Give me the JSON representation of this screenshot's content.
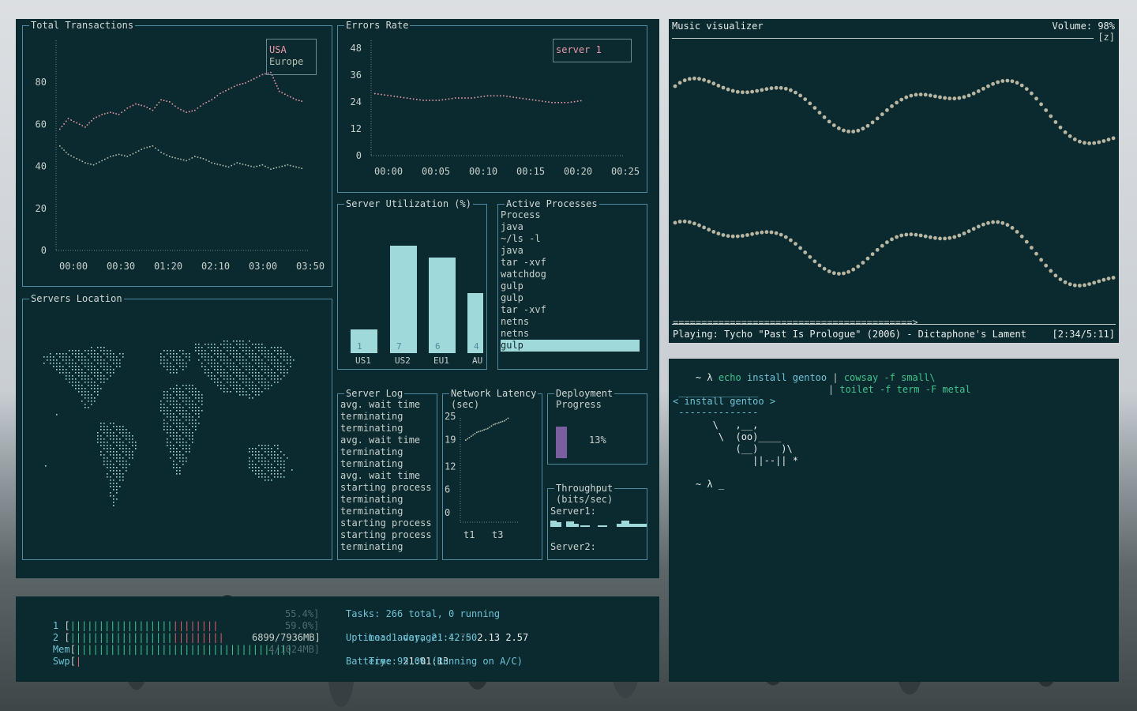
{
  "colors": {
    "panel_bg": "#0a2a30",
    "border": "#4e8aa0",
    "pink": "#e89aa6",
    "sage": "#b4bfb0",
    "bar": "#9fd9d9",
    "deploy": "#7a5ea0",
    "dots": "#b8b5a0"
  },
  "transactions": {
    "title": "Total Transactions",
    "legend": [
      "USA",
      "Europe"
    ],
    "yticks": [
      "80",
      "60",
      "40",
      "20",
      "0"
    ],
    "xticks": [
      "00:00",
      "00:30",
      "01:20",
      "02:10",
      "03:00",
      "03:50"
    ],
    "chart_data": {
      "type": "line",
      "ylim": [
        0,
        100
      ],
      "series": [
        {
          "name": "USA",
          "values": [
            58,
            63,
            61,
            59,
            63,
            65,
            66,
            65,
            68,
            70,
            69,
            67,
            72,
            71,
            68,
            66,
            67,
            70,
            72,
            75,
            77,
            79,
            80,
            82,
            84,
            85,
            76,
            74,
            72,
            71
          ]
        },
        {
          "name": "Europe",
          "values": [
            50,
            46,
            44,
            42,
            41,
            43,
            45,
            46,
            45,
            47,
            49,
            50,
            47,
            45,
            44,
            43,
            45,
            44,
            42,
            41,
            40,
            42,
            41,
            40,
            41,
            39,
            40,
            41,
            40,
            39
          ]
        }
      ]
    }
  },
  "errors": {
    "title": "Errors Rate",
    "legend": [
      "server 1"
    ],
    "yticks": [
      "48",
      "36",
      "24",
      "12",
      "0"
    ],
    "xticks": [
      "00:00",
      "00:05",
      "00:10",
      "00:15",
      "00:20",
      "00:25"
    ],
    "chart_data": {
      "type": "line",
      "ylim": [
        0,
        48
      ],
      "series": [
        {
          "name": "server 1",
          "values": [
            28,
            27,
            26,
            25,
            25,
            26,
            26,
            27,
            27,
            26,
            25,
            24,
            24,
            25
          ]
        }
      ]
    }
  },
  "utilization": {
    "title": "Server Utilization (%)",
    "chart_data": {
      "type": "bar",
      "categories": [
        "US1",
        "US2",
        "EU1",
        "AU"
      ],
      "values": [
        1,
        7,
        6,
        4
      ],
      "heights": [
        20,
        90,
        80,
        50
      ]
    }
  },
  "processes": {
    "title": "Active Processes",
    "header": "Process",
    "items": [
      "java",
      "~/ls -l",
      "java",
      "tar -xvf",
      "watchdog",
      "gulp",
      "gulp",
      "tar -xvf",
      "netns",
      "netns",
      "gulp"
    ]
  },
  "locations": {
    "title": "Servers Location"
  },
  "serverlog": {
    "title": "Server Log",
    "lines": [
      "avg. wait time",
      "terminating",
      "terminating",
      "avg. wait time",
      "terminating",
      "terminating",
      "avg. wait time",
      "starting process",
      "terminating",
      "terminating",
      "starting process",
      "starting process",
      "terminating"
    ]
  },
  "latency": {
    "title": "Network Latency",
    "subtitle": "(sec)",
    "yticks": [
      "25",
      "19",
      "12",
      "6",
      "0"
    ],
    "xticks": [
      "t1",
      "t3"
    ],
    "chart_data": {
      "type": "line",
      "ylim": [
        0,
        25
      ],
      "values": [
        19,
        20,
        21,
        21.5,
        22,
        23,
        23.5,
        24,
        25
      ]
    }
  },
  "deployment": {
    "title": "Deployment",
    "title2": "Progress",
    "value": "13%",
    "fraction": 0.13
  },
  "throughput": {
    "title": "Throughput",
    "subtitle": "(bits/sec)",
    "server1": "Server1:",
    "server2": "Server2:"
  },
  "visualizer": {
    "title": "Music visualizer",
    "volume": "Volume: 98%",
    "zoom": "[z]",
    "progress_bar": "==========================================>",
    "playing": "Playing: Tycho \"Past Is Prologue\" (2006) - Dictaphone's Lament",
    "time": "[2:34/5:11]"
  },
  "shell": {
    "prompt": "~ λ",
    "cmd1": "echo",
    "cmd1_args": "install gentoo",
    "pipe": "|",
    "cmd2": "cowsay -f small\\",
    "cmd3": "toilet -f term -F metal",
    "cow_line1": " ______________",
    "cow_say": "< install gentoo >",
    "cow_line2": " --------------",
    "cow_art": "       \\   ,__,\n        \\  (oo)____\n           (__)    )\\\n              ||--|| *",
    "prompt2": "~ λ",
    "cursor": "_"
  },
  "htop": {
    "cpu1_label": "1",
    "cpu1_bars": "||||||||||||||||||",
    "cpu1_bars_red": "||||||||",
    "cpu1_val": "55.4%]",
    "cpu2_label": "2",
    "cpu2_bars": "||||||||||||||||||",
    "cpu2_bars_red": "|||||||||",
    "cpu2_val": "59.0%]",
    "mem_label": "Mem",
    "mem_bars": "||||||||||||||||||||||||||||||||||||||",
    "mem_val": "6899/7936MB]",
    "swp_label": "Swp",
    "swp_bars": "|",
    "swp_val": "4/1024MB]",
    "tasks": "Tasks: 266 total, 0 running",
    "load_label": "Load average:",
    "load1": "1.70",
    "load2": "2.13 2.57",
    "uptime": "Uptime: 1 day, 21:42:50",
    "time_label": "Time:",
    "time_val": "21:01:13",
    "battery": "Battery: 95.0% (Running on A/C)"
  }
}
